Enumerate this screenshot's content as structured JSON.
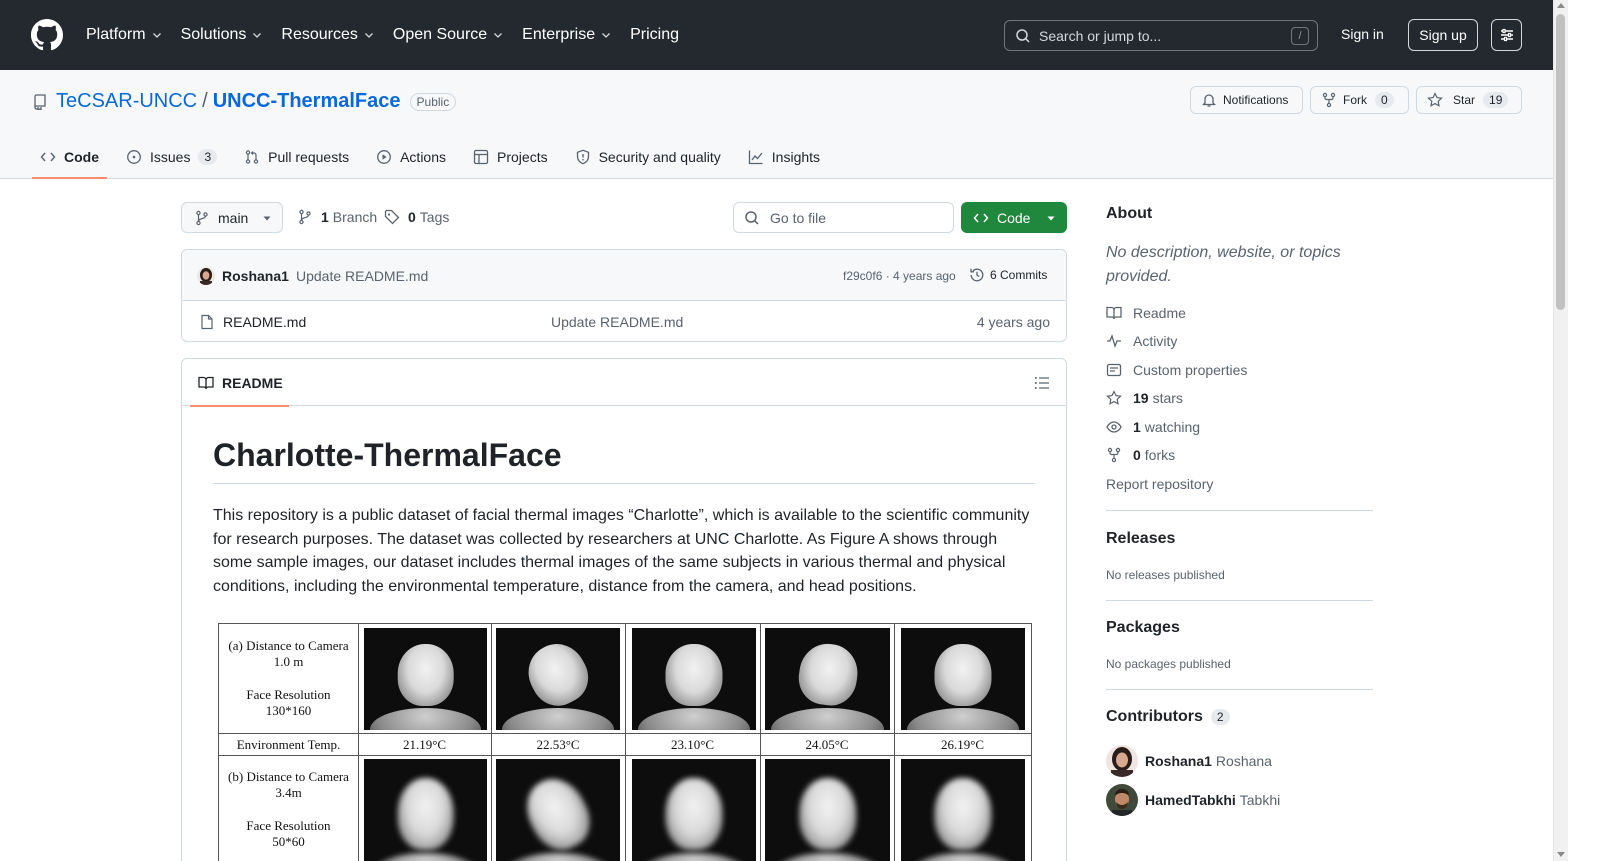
{
  "header": {
    "nav": [
      {
        "label": "Platform",
        "dropdown": true
      },
      {
        "label": "Solutions",
        "dropdown": true
      },
      {
        "label": "Resources",
        "dropdown": true
      },
      {
        "label": "Open Source",
        "dropdown": true
      },
      {
        "label": "Enterprise",
        "dropdown": true
      },
      {
        "label": "Pricing",
        "dropdown": false
      }
    ],
    "search_placeholder": "Search or jump to...",
    "search_shortcut": "/",
    "signin": "Sign in",
    "signup": "Sign up"
  },
  "repo": {
    "owner": "TeCSAR-UNCC",
    "separator": "/",
    "name": "UNCC-ThermalFace",
    "visibility": "Public",
    "notifications_label": "Notifications",
    "fork_label": "Fork",
    "fork_count": "0",
    "star_label": "Star",
    "star_count": "19",
    "tabs": [
      {
        "label": "Code",
        "icon": "code-icon",
        "count": ""
      },
      {
        "label": "Issues",
        "icon": "issue-icon",
        "count": "3"
      },
      {
        "label": "Pull requests",
        "icon": "pull-request-icon",
        "count": ""
      },
      {
        "label": "Actions",
        "icon": "play-icon",
        "count": ""
      },
      {
        "label": "Projects",
        "icon": "table-icon",
        "count": ""
      },
      {
        "label": "Security and quality",
        "icon": "shield-icon",
        "count": ""
      },
      {
        "label": "Insights",
        "icon": "graph-icon",
        "count": ""
      }
    ]
  },
  "filebar": {
    "branch": "main",
    "branch_count": "1",
    "branch_label": "Branch",
    "tag_count": "0",
    "tag_label": "Tags",
    "goto_placeholder": "Go to file",
    "code_button": "Code"
  },
  "commit": {
    "author": "Roshana1",
    "message": "Update README.md",
    "sha_age": "f29c0f6 · 4 years ago",
    "commits_label": "6 Commits"
  },
  "files": [
    {
      "name": "README.md",
      "message": "Update README.md",
      "age": "4 years ago"
    }
  ],
  "readme": {
    "tab_label": "README",
    "title": "Charlotte-ThermalFace",
    "paragraph": "This repository is a public dataset of facial thermal images “Charlotte”, which is available to the scientific community for research purposes. The dataset was collected by researchers at UNC Charlotte. As Figure A shows through some sample images, our dataset includes thermal images of the same subjects in various thermal and physical conditions, including the environmental temperature, distance from the camera, and head positions.",
    "figure": {
      "row_a": {
        "distance": "(a) Distance to Camera",
        "distance_value": "1.0 m",
        "resolution": "Face Resolution",
        "resolution_value": "130*160"
      },
      "env_label": "Environment Temp.",
      "temps": [
        "21.19°C",
        "22.53°C",
        "23.10°C",
        "24.05°C",
        "26.19°C"
      ],
      "row_b": {
        "distance": "(b) Distance to Camera",
        "distance_value": "3.4m",
        "resolution": "Face Resolution",
        "resolution_value": "50*60"
      }
    }
  },
  "sidebar": {
    "about_title": "About",
    "about_desc": "No description, website, or topics provided.",
    "readme": "Readme",
    "activity": "Activity",
    "custom_properties": "Custom properties",
    "stars_count": "19",
    "stars_label": "stars",
    "watching_count": "1",
    "watching_label": "watching",
    "forks_count": "0",
    "forks_label": "forks",
    "report": "Report repository",
    "releases_title": "Releases",
    "releases_empty": "No releases published",
    "packages_title": "Packages",
    "packages_empty": "No packages published",
    "contributors_title": "Contributors",
    "contributors_count": "2",
    "contributors": [
      {
        "login": "Roshana1",
        "name": "Roshana"
      },
      {
        "login": "HamedTabkhi",
        "name": "Tabkhi"
      }
    ]
  },
  "colors": {
    "header_bg": "#24292f",
    "link": "#0969da",
    "primary_button": "#1f883d",
    "tab_underline": "#fd8c73",
    "muted_text": "#59636e",
    "border": "#d1d9e0"
  }
}
